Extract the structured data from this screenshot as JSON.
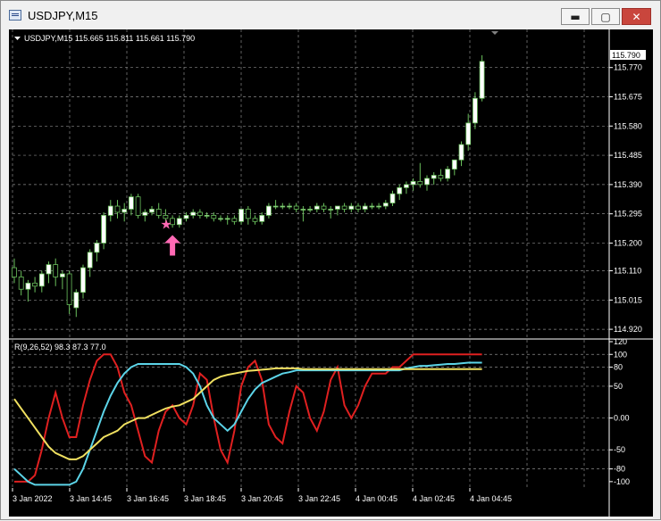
{
  "window": {
    "title": "USDJPY,M15",
    "buttons": {
      "minimize": "▬",
      "maximize": "▢",
      "close": "✕"
    }
  },
  "price_panel": {
    "header": "USDJPY,M15  115.665 115.811 115.661 115.790",
    "current_price": "115.790",
    "y_ticks": [
      "115.770",
      "115.675",
      "115.580",
      "115.485",
      "115.390",
      "115.295",
      "115.200",
      "115.110",
      "115.015",
      "114.920"
    ],
    "signal_markers": {
      "star": "★",
      "arrow": "up"
    }
  },
  "indicator_panel": {
    "header": "R(9,26,52) 98.3 87.3 77.0",
    "y_ticks": [
      "120",
      "100",
      "80",
      "50",
      "0.00",
      "-50",
      "-80",
      "-100"
    ]
  },
  "x_ticks": [
    "3 Jan 2022",
    "3 Jan 14:45",
    "3 Jan 16:45",
    "3 Jan 18:45",
    "3 Jan 20:45",
    "3 Jan 22:45",
    "4 Jan 00:45",
    "4 Jan 02:45",
    "4 Jan 04:45"
  ],
  "colors": {
    "background": "#000000",
    "grid": "#8a8a8a",
    "bull_candle": "#ffffff",
    "bear_candle": "#000000",
    "candle_wick": "#6abf5c",
    "rsi_fast": "#e02020",
    "rsi_medium": "#5cd4e8",
    "rsi_slow": "#f0e060",
    "star": "#ff69b4",
    "arrow": "#ff69b4"
  },
  "chart_data": [
    {
      "type": "candlestick",
      "title": "USDJPY,M15",
      "ylim": [
        114.9,
        115.83
      ],
      "x": [
        "3 Jan 2022",
        "3 Jan 14:45",
        "3 Jan 16:45",
        "3 Jan 18:45",
        "3 Jan 20:45",
        "3 Jan 22:45",
        "4 Jan 00:45",
        "4 Jan 02:45",
        "4 Jan 04:45"
      ],
      "series": [
        {
          "ohlc": [
            [
              115.12,
              115.15,
              115.07,
              115.09
            ],
            [
              115.09,
              115.11,
              115.03,
              115.05
            ],
            [
              115.05,
              115.08,
              115.01,
              115.07
            ],
            [
              115.07,
              115.09,
              115.04,
              115.06
            ],
            [
              115.06,
              115.11,
              115.04,
              115.1
            ],
            [
              115.1,
              115.14,
              115.07,
              115.13
            ],
            [
              115.13,
              115.15,
              115.06,
              115.09
            ],
            [
              115.09,
              115.11,
              115.05,
              115.1
            ],
            [
              115.1,
              115.11,
              114.97,
              115.0
            ],
            [
              114.99,
              115.05,
              114.96,
              115.04
            ],
            [
              115.04,
              115.13,
              115.02,
              115.12
            ],
            [
              115.12,
              115.18,
              115.09,
              115.17
            ],
            [
              115.17,
              115.21,
              115.14,
              115.2
            ],
            [
              115.2,
              115.3,
              115.18,
              115.29
            ],
            [
              115.29,
              115.34,
              115.27,
              115.32
            ],
            [
              115.32,
              115.34,
              115.28,
              115.3
            ],
            [
              115.3,
              115.33,
              115.27,
              115.31
            ],
            [
              115.31,
              115.36,
              115.29,
              115.35
            ],
            [
              115.35,
              115.36,
              115.28,
              115.29
            ],
            [
              115.29,
              115.31,
              115.27,
              115.3
            ],
            [
              115.3,
              115.32,
              115.29,
              115.31
            ],
            [
              115.31,
              115.33,
              115.28,
              115.29
            ],
            [
              115.29,
              115.31,
              115.27,
              115.28
            ],
            [
              115.28,
              115.29,
              115.25,
              115.26
            ],
            [
              115.26,
              115.29,
              115.25,
              115.28
            ],
            [
              115.28,
              115.3,
              115.27,
              115.29
            ],
            [
              115.29,
              115.31,
              115.28,
              115.3
            ],
            [
              115.3,
              115.31,
              115.28,
              115.29
            ],
            [
              115.29,
              115.3,
              115.28,
              115.29
            ],
            [
              115.29,
              115.3,
              115.27,
              115.28
            ],
            [
              115.28,
              115.29,
              115.27,
              115.28
            ],
            [
              115.28,
              115.29,
              115.26,
              115.28
            ],
            [
              115.28,
              115.29,
              115.26,
              115.27
            ],
            [
              115.27,
              115.31,
              115.26,
              115.31
            ],
            [
              115.31,
              115.32,
              115.26,
              115.28
            ],
            [
              115.28,
              115.29,
              115.26,
              115.27
            ],
            [
              115.27,
              115.3,
              115.26,
              115.29
            ],
            [
              115.29,
              115.33,
              115.28,
              115.32
            ],
            [
              115.32,
              115.34,
              115.31,
              115.32
            ],
            [
              115.32,
              115.33,
              115.31,
              115.32
            ],
            [
              115.32,
              115.33,
              115.31,
              115.32
            ],
            [
              115.32,
              115.33,
              115.3,
              115.31
            ],
            [
              115.31,
              115.32,
              115.27,
              115.31
            ],
            [
              115.31,
              115.32,
              115.3,
              115.31
            ],
            [
              115.31,
              115.33,
              115.3,
              115.32
            ],
            [
              115.32,
              115.33,
              115.3,
              115.31
            ],
            [
              115.31,
              115.32,
              115.28,
              115.31
            ],
            [
              115.31,
              115.32,
              115.29,
              115.32
            ],
            [
              115.32,
              115.33,
              115.3,
              115.31
            ],
            [
              115.31,
              115.33,
              115.3,
              115.32
            ],
            [
              115.32,
              115.33,
              115.3,
              115.31
            ],
            [
              115.31,
              115.33,
              115.3,
              115.32
            ],
            [
              115.32,
              115.33,
              115.31,
              115.32
            ],
            [
              115.32,
              115.33,
              115.31,
              115.32
            ],
            [
              115.32,
              115.34,
              115.31,
              115.33
            ],
            [
              115.33,
              115.37,
              115.32,
              115.36
            ],
            [
              115.36,
              115.39,
              115.34,
              115.38
            ],
            [
              115.38,
              115.4,
              115.36,
              115.39
            ],
            [
              115.39,
              115.41,
              115.37,
              115.4
            ],
            [
              115.4,
              115.46,
              115.38,
              115.39
            ],
            [
              115.39,
              115.42,
              115.37,
              115.41
            ],
            [
              115.41,
              115.43,
              115.39,
              115.42
            ],
            [
              115.42,
              115.44,
              115.4,
              115.41
            ],
            [
              115.41,
              115.45,
              115.4,
              115.44
            ],
            [
              115.44,
              115.47,
              115.42,
              115.47
            ],
            [
              115.47,
              115.53,
              115.45,
              115.52
            ],
            [
              115.52,
              115.62,
              115.5,
              115.59
            ],
            [
              115.59,
              115.69,
              115.57,
              115.67
            ],
            [
              115.67,
              115.81,
              115.66,
              115.79
            ]
          ]
        }
      ],
      "annotations": [
        {
          "type": "star",
          "x_index": 22,
          "y": 115.26
        },
        {
          "type": "arrow_up",
          "x_index": 23,
          "y": 115.2
        }
      ]
    },
    {
      "type": "line",
      "title": "R(9,26,52) 98.3 87.3 77.0",
      "ylim": [
        -110,
        120
      ],
      "x": [
        "3 Jan 2022",
        "3 Jan 14:45",
        "3 Jan 16:45",
        "3 Jan 18:45",
        "3 Jan 20:45",
        "3 Jan 22:45",
        "4 Jan 00:45",
        "4 Jan 02:45",
        "4 Jan 04:45"
      ],
      "series": [
        {
          "name": "R(9)",
          "values": [
            -100,
            -100,
            -100,
            -90,
            -50,
            0,
            40,
            0,
            -30,
            -30,
            20,
            60,
            90,
            100,
            100,
            80,
            40,
            20,
            -20,
            -60,
            -70,
            -20,
            10,
            20,
            0,
            -10,
            20,
            70,
            60,
            0,
            -50,
            -70,
            -20,
            50,
            80,
            90,
            60,
            -10,
            -30,
            -40,
            10,
            50,
            40,
            0,
            -20,
            10,
            60,
            80,
            20,
            0,
            20,
            50,
            70,
            70,
            70,
            80,
            80,
            90,
            100,
            100,
            100,
            100,
            100,
            100,
            100,
            100,
            100,
            100,
            100
          ]
        },
        {
          "name": "R(26)",
          "values": [
            -80,
            -90,
            -100,
            -105,
            -105,
            -105,
            -105,
            -105,
            -105,
            -100,
            -80,
            -50,
            -20,
            10,
            35,
            55,
            70,
            80,
            85,
            85,
            85,
            85,
            85,
            85,
            85,
            80,
            70,
            50,
            20,
            0,
            -10,
            -20,
            -10,
            10,
            30,
            45,
            55,
            60,
            65,
            70,
            72,
            75,
            75,
            75,
            75,
            75,
            75,
            75,
            75,
            75,
            75,
            75,
            75,
            75,
            75,
            75,
            75,
            78,
            80,
            82,
            82,
            83,
            84,
            85,
            85,
            86,
            87,
            87,
            87
          ]
        },
        {
          "name": "R(52)",
          "values": [
            30,
            15,
            0,
            -15,
            -30,
            -45,
            -55,
            -60,
            -65,
            -65,
            -60,
            -50,
            -40,
            -30,
            -25,
            -20,
            -10,
            -5,
            0,
            0,
            5,
            10,
            15,
            18,
            20,
            25,
            30,
            40,
            50,
            60,
            65,
            68,
            70,
            72,
            74,
            75,
            76,
            77,
            78,
            78,
            78,
            78,
            77,
            77,
            77,
            77,
            77,
            77,
            77,
            77,
            77,
            77,
            77,
            77,
            77,
            77,
            77,
            77,
            77,
            77,
            77,
            77,
            77,
            77,
            77,
            77,
            77,
            77,
            77
          ]
        }
      ]
    }
  ]
}
